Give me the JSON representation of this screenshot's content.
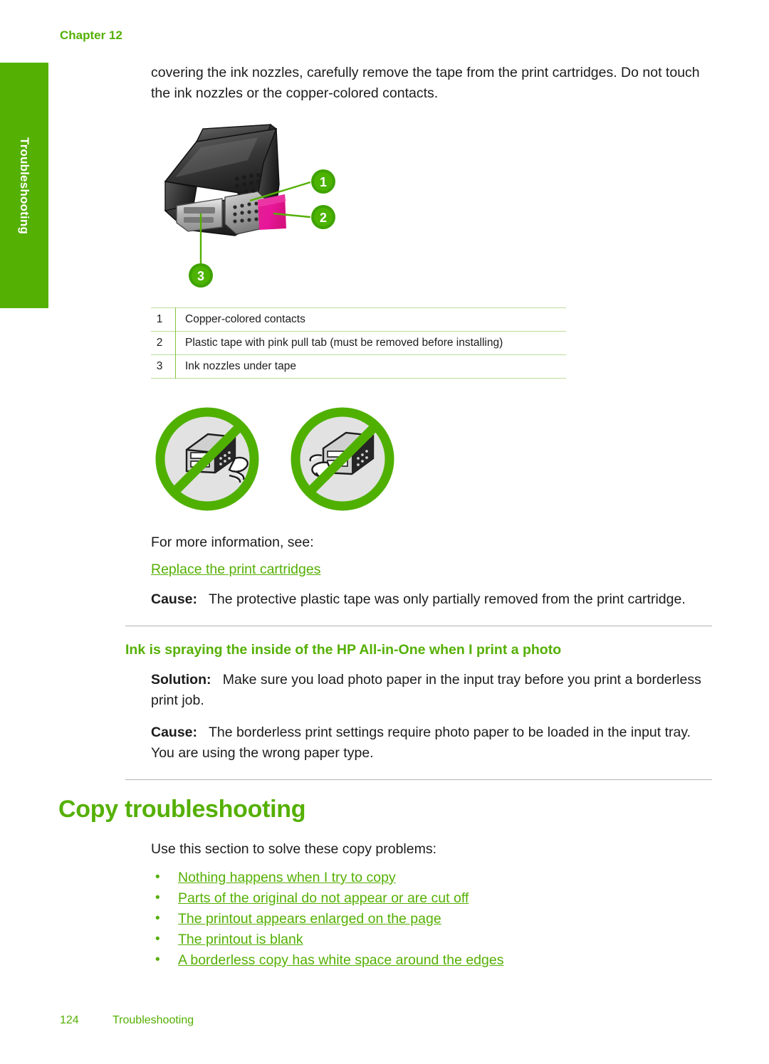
{
  "page": {
    "chapter_label": "Chapter 12",
    "side_tab_label": "Troubleshooting",
    "accent_green": "#55b004",
    "rule_gray": "#b3b3b3"
  },
  "intro": {
    "paragraph": "covering the ink nozzles, carefully remove the tape from the print cartridges. Do not touch the ink nozzles or the copper-colored contacts."
  },
  "figure_cartridge": {
    "alt": "print cartridge with numbered callouts",
    "callouts": [
      {
        "number": "1"
      },
      {
        "number": "2"
      },
      {
        "number": "3"
      }
    ]
  },
  "legend": {
    "rows": [
      {
        "num": "1",
        "desc": "Copper-colored contacts"
      },
      {
        "num": "2",
        "desc": "Plastic tape with pink pull tab (must be removed before installing)"
      },
      {
        "num": "3",
        "desc": "Ink nozzles under tape"
      }
    ]
  },
  "figure_no_touch": {
    "icon_left_alt": "do not touch ink nozzles",
    "icon_right_alt": "do not touch copper-colored contacts"
  },
  "more_info": {
    "intro": "For more information, see:",
    "link": "Replace the print cartridges"
  },
  "cause_tape": {
    "label": "Cause:",
    "text": "The protective plastic tape was only partially removed from the print cartridge."
  },
  "ink_spraying": {
    "heading": "Ink is spraying the inside of the HP All-in-One when I print a photo",
    "solution_label": "Solution:",
    "solution_text": "Make sure you load photo paper in the input tray before you print a borderless print job.",
    "cause_label": "Cause:",
    "cause_text": "The borderless print settings require photo paper to be loaded in the input tray. You are using the wrong paper type."
  },
  "copy_troubleshooting": {
    "heading": "Copy troubleshooting",
    "intro": "Use this section to solve these copy problems:",
    "links": [
      "Nothing happens when I try to copy",
      "Parts of the original do not appear or are cut off",
      "The printout appears enlarged on the page",
      "The printout is blank",
      "A borderless copy has white space around the edges"
    ],
    "bullet_glyph": "•"
  },
  "footer": {
    "page_number": "124",
    "section": "Troubleshooting"
  }
}
